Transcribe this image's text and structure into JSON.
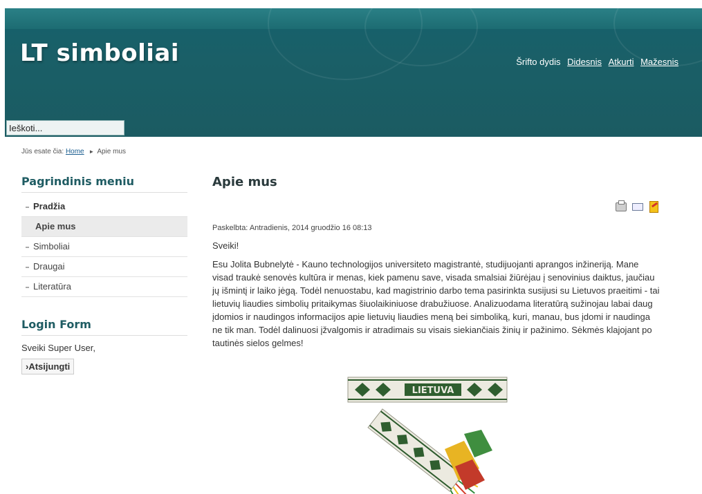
{
  "site": {
    "title": "LT simboliai"
  },
  "font_size": {
    "label": "Šrifto dydis",
    "larger": "Didesnis",
    "reset": "Atkurti",
    "smaller": "Mažesnis"
  },
  "search": {
    "placeholder": "Ieškoti..."
  },
  "breadcrumb": {
    "prefix": "Jūs esate čia:",
    "home": "Home",
    "current": "Apie mus"
  },
  "main_menu": {
    "title": "Pagrindinis meniu",
    "items": [
      {
        "label": "Pradžia"
      },
      {
        "label": "Apie mus"
      },
      {
        "label": "Simboliai"
      },
      {
        "label": "Draugai"
      },
      {
        "label": "Literatūra"
      }
    ]
  },
  "login": {
    "title": "Login Form",
    "greeting": "Sveiki Super User,",
    "logout": "›Atsijungti"
  },
  "article": {
    "title": "Apie mus",
    "published": "Paskelbta: Antradienis, 2014 gruodžio 16 08:13",
    "greeting": "Sveiki!",
    "body": "Esu Jolita Bubnelytė - Kauno technologijos universiteto magistrantė, studijuojanti aprangos inžineriją. Mane visad traukė senovės kultūra ir menas, kiek pamenu save, visada smalsiai žiūrėjau į senovinius daiktus, jaučiau jų išmintį ir laiko jėgą. Todėl nenuostabu, kad magistrinio darbo tema pasirinkta susijusi su Lietuvos praeitimi - tai lietuvių liaudies simbolių pritaikymas šiuolaikiniuose drabužiuose. Analizuodama literatūrą sužinojau labai daug įdomios ir naudingos informacijos apie lietuvių liaudies meną bei simboliką, kuri, manau, bus įdomi ir naudinga ne tik man. Todėl dalinuosi įžvalgomis ir atradimais su visais siekiančiais žinių ir pažinimo. Sėkmės klajojant po tautinės sielos gelmes!",
    "image_text": "LIETUVA"
  },
  "icons": [
    "printer-icon",
    "email-icon",
    "pdf-icon"
  ],
  "colors": {
    "header": "#1b5b62",
    "title_text": "#1f5c63",
    "link": "#1a5d8f"
  }
}
